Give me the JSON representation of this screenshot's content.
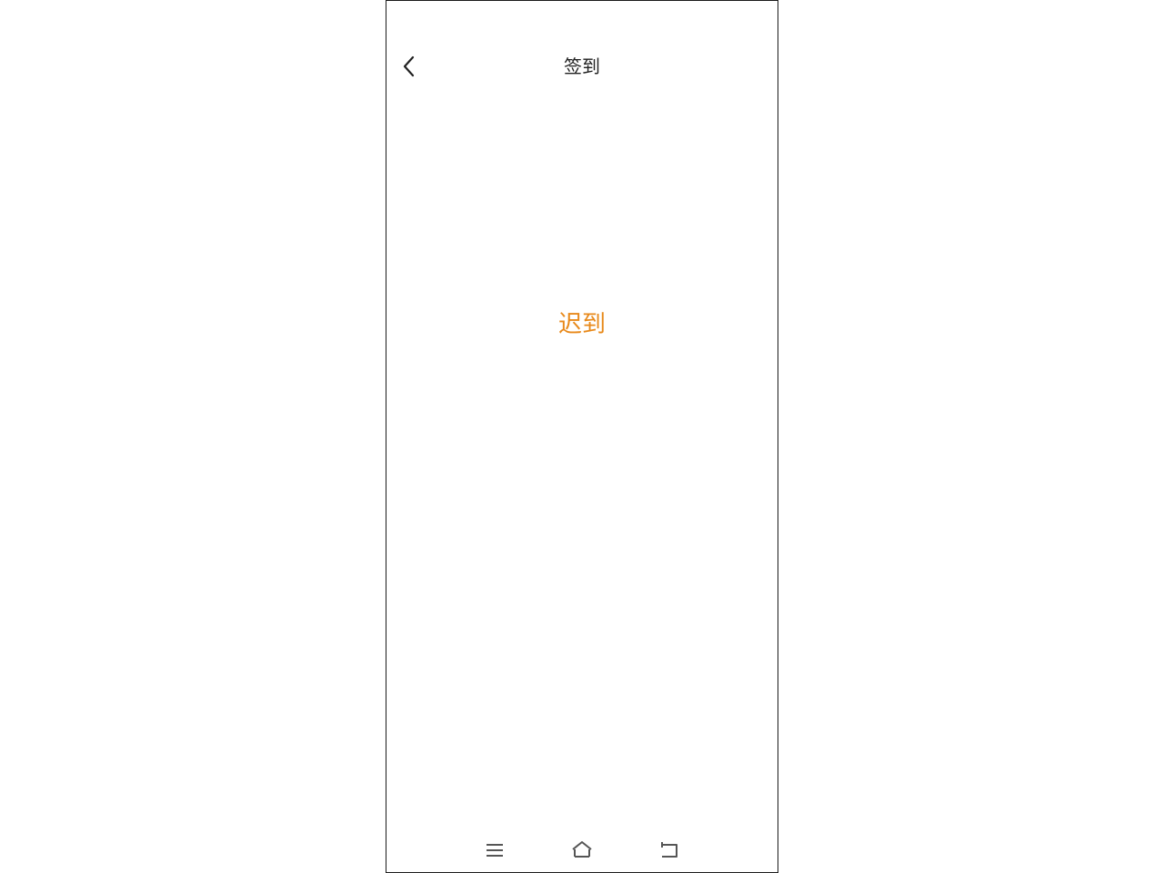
{
  "header": {
    "title": "签到",
    "back_icon": "chevron-left-icon"
  },
  "main": {
    "status_text": "迟到",
    "status_color": "#e8891a"
  },
  "system_nav": {
    "menu_icon": "menu-icon",
    "home_icon": "home-icon",
    "back_icon": "return-icon"
  }
}
